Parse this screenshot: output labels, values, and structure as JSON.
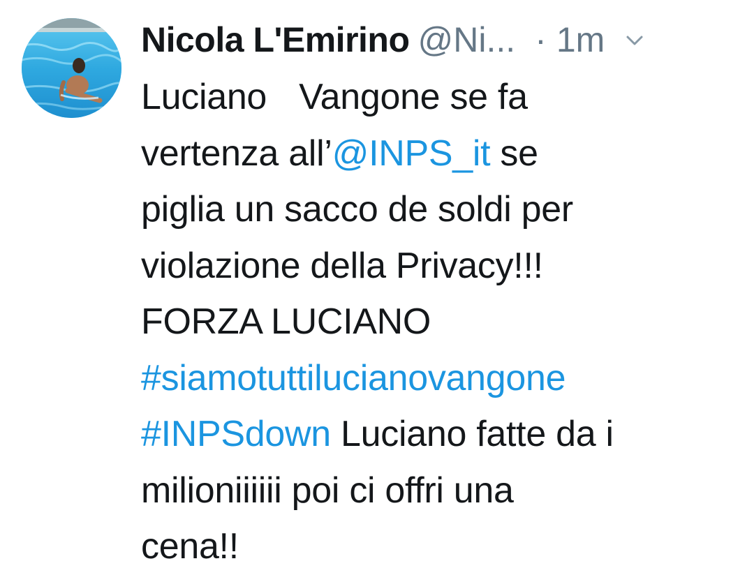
{
  "user": {
    "display_name": "Nicola L'Emirino",
    "handle": "@Ni...",
    "separator": "·",
    "time": "1m",
    "avatar_icon": "avatar-swimmer-pool"
  },
  "tweet": {
    "line1_a": "Luciano",
    "line1_b": "Vangone se fa",
    "line2_a": "vertenza all’",
    "mention": "@INPS_it",
    "line2_b": " se",
    "line3": "piglia un sacco de soldi per",
    "line4": "violazione della Privacy!!!",
    "line5": "FORZA LUCIANO",
    "hashtag1": "#siamotuttilucianovangone",
    "hashtag2": "#INPSdown",
    "line7_b": " Luciano fatte da i",
    "line8": "milioniiiiii poi ci offri una",
    "line9": "cena!!"
  },
  "colors": {
    "text": "#14171a",
    "secondary": "#657786",
    "link": "#1b95e0"
  }
}
